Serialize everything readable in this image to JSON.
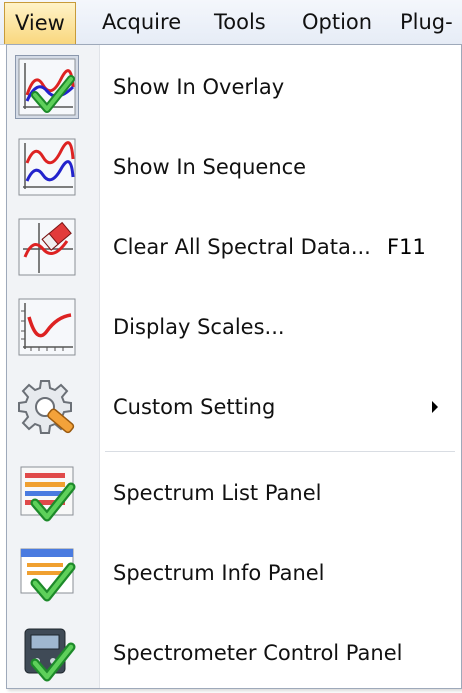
{
  "menubar": {
    "items": [
      "View",
      "Acquire",
      "Tools",
      "Option",
      "Plug-"
    ]
  },
  "menu": {
    "items": [
      {
        "label": "Show In Overlay",
        "icon": "overlay-chart-check-icon",
        "checked": true
      },
      {
        "label": "Show In Sequence",
        "icon": "sequence-chart-icon"
      },
      {
        "label": "Clear All Spectral Data...",
        "shortcut": "F11",
        "icon": "eraser-chart-icon"
      },
      {
        "label": "Display Scales...",
        "icon": "scale-chart-icon"
      },
      {
        "label": "Custom Setting",
        "icon": "gear-wrench-icon",
        "submenu": true
      },
      {
        "label": "Spectrum List Panel",
        "icon": "list-panel-check-icon"
      },
      {
        "label": "Spectrum Info Panel",
        "icon": "info-panel-check-icon"
      },
      {
        "label": "Spectrometer Control Panel",
        "icon": "spectrometer-check-icon"
      }
    ]
  }
}
